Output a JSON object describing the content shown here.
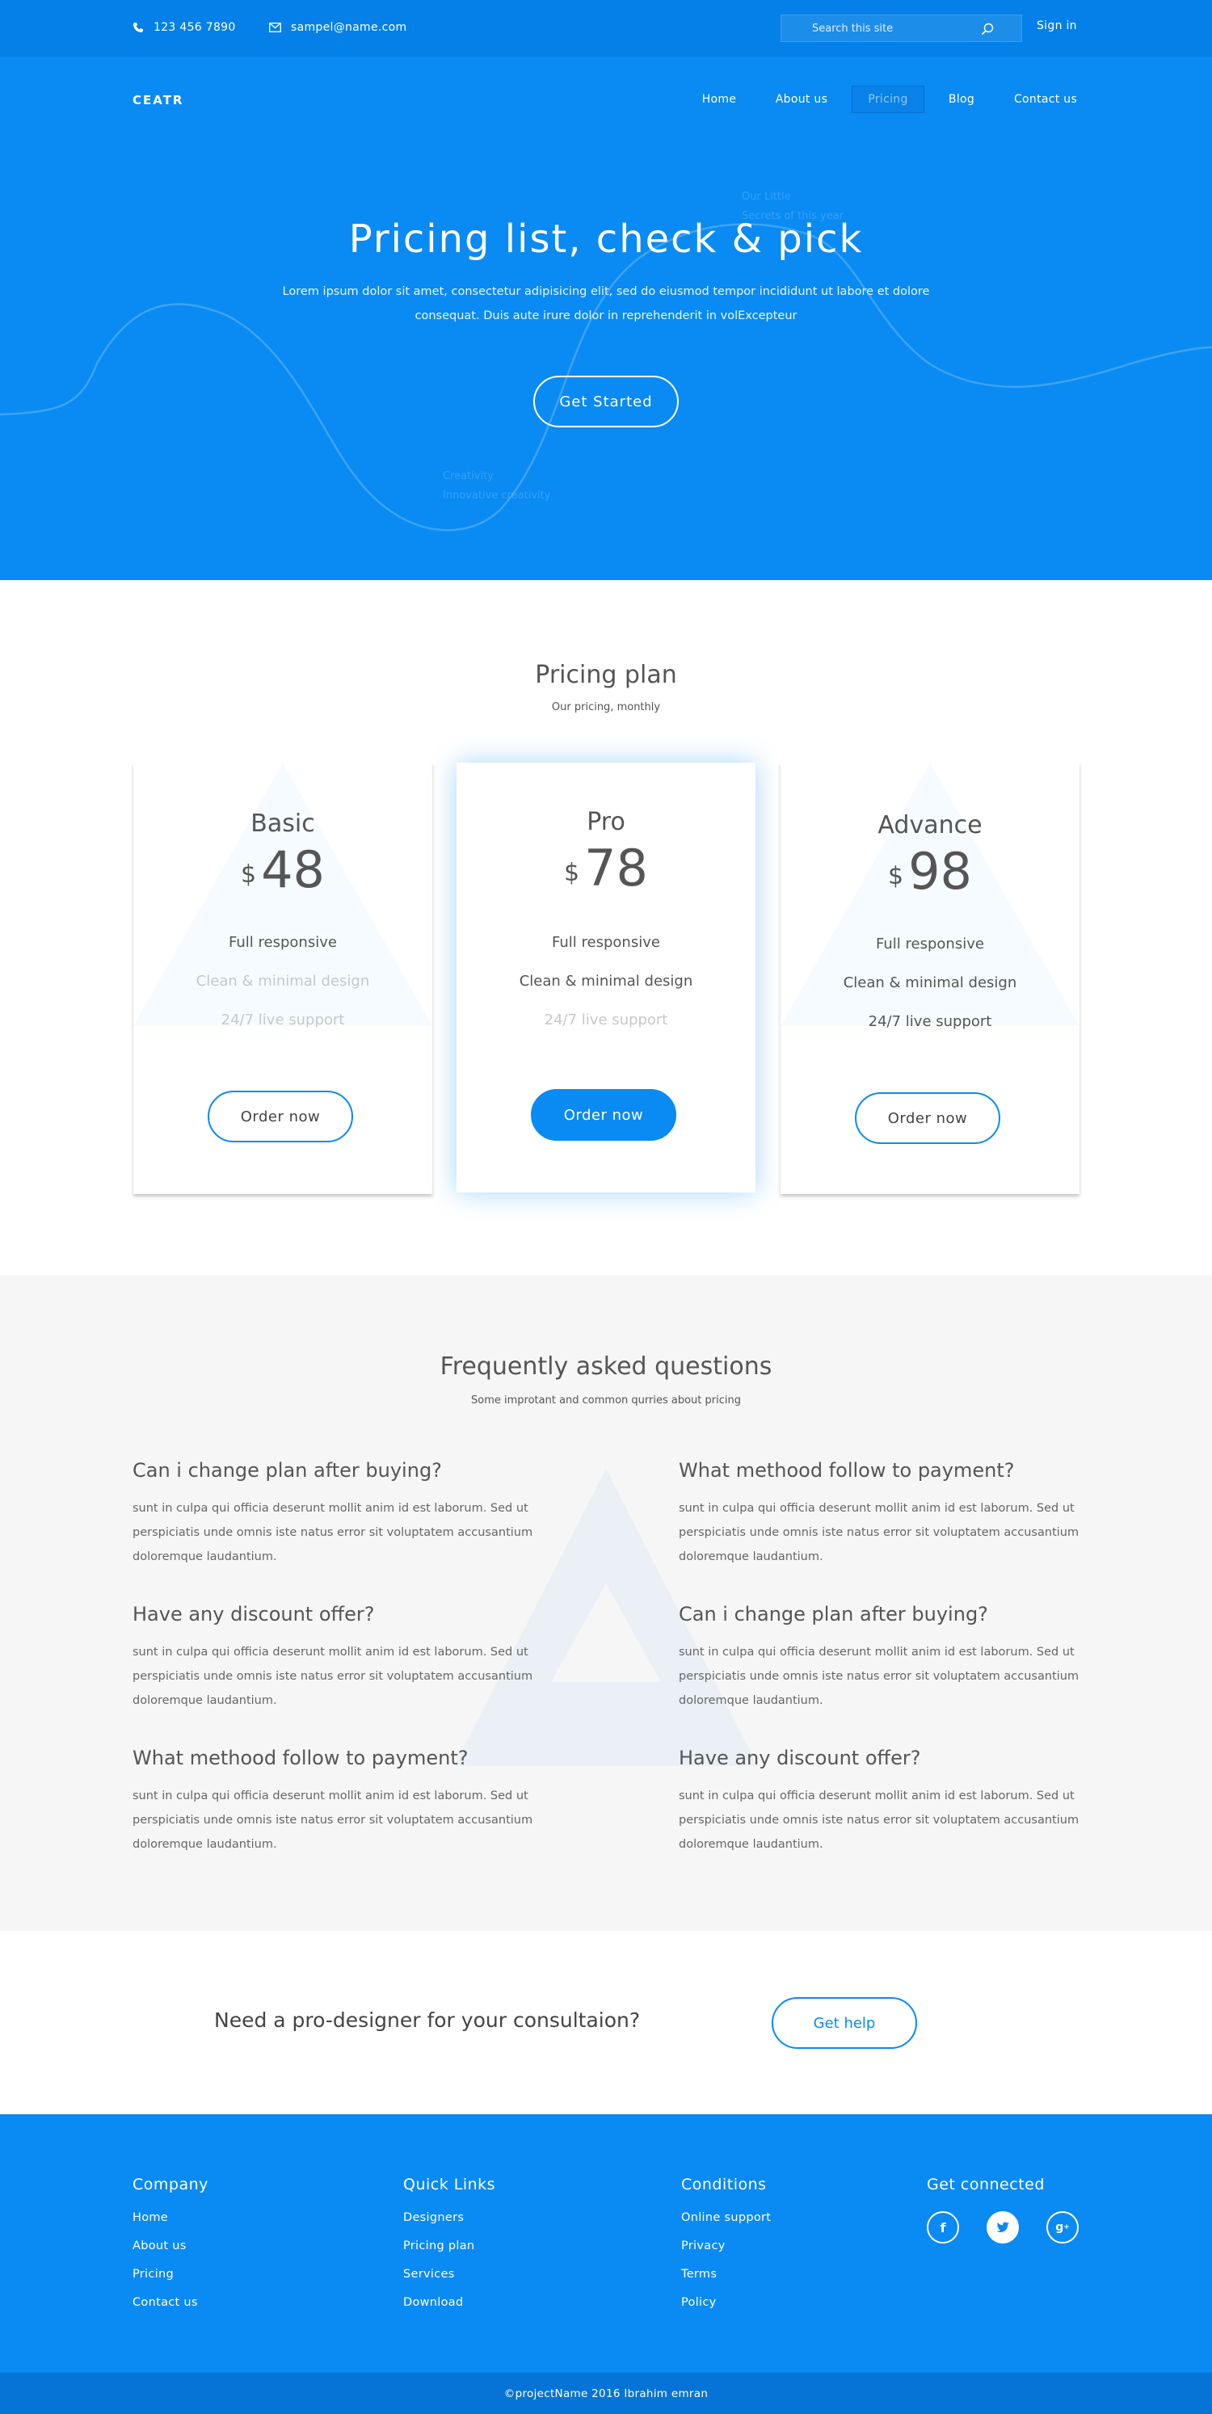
{
  "topbar": {
    "phone": "123 456 7890",
    "email": "sampel@name.com",
    "search_placeholder": "Search this site",
    "signin": "Sign in"
  },
  "header": {
    "logo": "CEATR",
    "nav": [
      "Home",
      "About us",
      "Pricing",
      "Blog",
      "Contact us"
    ],
    "active_nav": "Pricing"
  },
  "hero": {
    "title": "Pricing list, check & pick",
    "subtitle": "Lorem ipsum dolor sit amet, consectetur adipisicing elit, sed do eiusmod tempor incididunt ut labore et dolore consequat. Duis aute irure dolor in reprehenderit in volExcepteur",
    "button": "Get Started",
    "faint_text_1a": "Our Little",
    "faint_text_1b": "Secrets of this year",
    "faint_text_2a": "Creativity",
    "faint_text_2b": "Innovative creativity"
  },
  "pricing": {
    "title": "Pricing plan",
    "subtitle": "Our pricing, monthly",
    "currency": "$",
    "order_label": "Order now",
    "plans": [
      {
        "name": "Basic",
        "price": "48",
        "features": [
          "Full responsive",
          "Clean & minimal design",
          "24/7 live support"
        ],
        "included": [
          true,
          false,
          false
        ]
      },
      {
        "name": "Pro",
        "price": "78",
        "features": [
          "Full responsive",
          "Clean & minimal design",
          "24/7 live support"
        ],
        "included": [
          true,
          true,
          false
        ]
      },
      {
        "name": "Advance",
        "price": "98",
        "features": [
          "Full responsive",
          "Clean & minimal design",
          "24/7 live support"
        ],
        "included": [
          true,
          true,
          true
        ]
      }
    ]
  },
  "faq": {
    "title": "Frequently asked questions",
    "subtitle": "Some improtant and common qurries about pricing",
    "items": [
      {
        "q": "Can i change plan after buying?",
        "a": "sunt in culpa qui officia deserunt mollit anim id est laborum. Sed ut perspiciatis unde omnis iste natus error sit voluptatem accusantium doloremque laudantium."
      },
      {
        "q": "What methood follow to payment?",
        "a": "sunt in culpa qui officia deserunt mollit anim id est laborum. Sed ut perspiciatis unde omnis iste natus error sit voluptatem accusantium doloremque laudantium."
      },
      {
        "q": "Have any discount offer?",
        "a": "sunt in culpa qui officia deserunt mollit anim id est laborum. Sed ut perspiciatis unde omnis iste natus error sit voluptatem accusantium doloremque laudantium."
      },
      {
        "q": "Can i change plan after buying?",
        "a": "sunt in culpa qui officia deserunt mollit anim id est laborum. Sed ut perspiciatis unde omnis iste natus error sit voluptatem accusantium doloremque laudantium."
      },
      {
        "q": "What methood follow to payment?",
        "a": "sunt in culpa qui officia deserunt mollit anim id est laborum. Sed ut perspiciatis unde omnis iste natus error sit voluptatem accusantium doloremque laudantium."
      },
      {
        "q": "Have any discount offer?",
        "a": "sunt in culpa qui officia deserunt mollit anim id est laborum. Sed ut perspiciatis unde omnis iste natus error sit voluptatem accusantium doloremque laudantium."
      }
    ]
  },
  "cta": {
    "text": "Need a pro-designer for your consultaion?",
    "button": "Get help"
  },
  "footer": {
    "company": {
      "title": "Company",
      "links": [
        "Home",
        "About us",
        "Pricing",
        "Contact us"
      ]
    },
    "quick_links": {
      "title": "Quick Links",
      "links": [
        "Designers",
        "Pricing plan",
        "Services",
        "Download"
      ]
    },
    "conditions": {
      "title": "Conditions",
      "links": [
        "Online support",
        "Privacy",
        "Terms",
        "Policy"
      ]
    },
    "connected": {
      "title": "Get connected",
      "icons": [
        "facebook-icon",
        "twitter-icon",
        "google-plus-icon"
      ]
    },
    "copyright": "©projectName 2016 Ibrahim emran"
  },
  "colors": {
    "primary": "#0a8af3",
    "topbar": "#0480e8",
    "footer_bottom": "#0674d6",
    "faq_bg": "#f6f6f6"
  }
}
